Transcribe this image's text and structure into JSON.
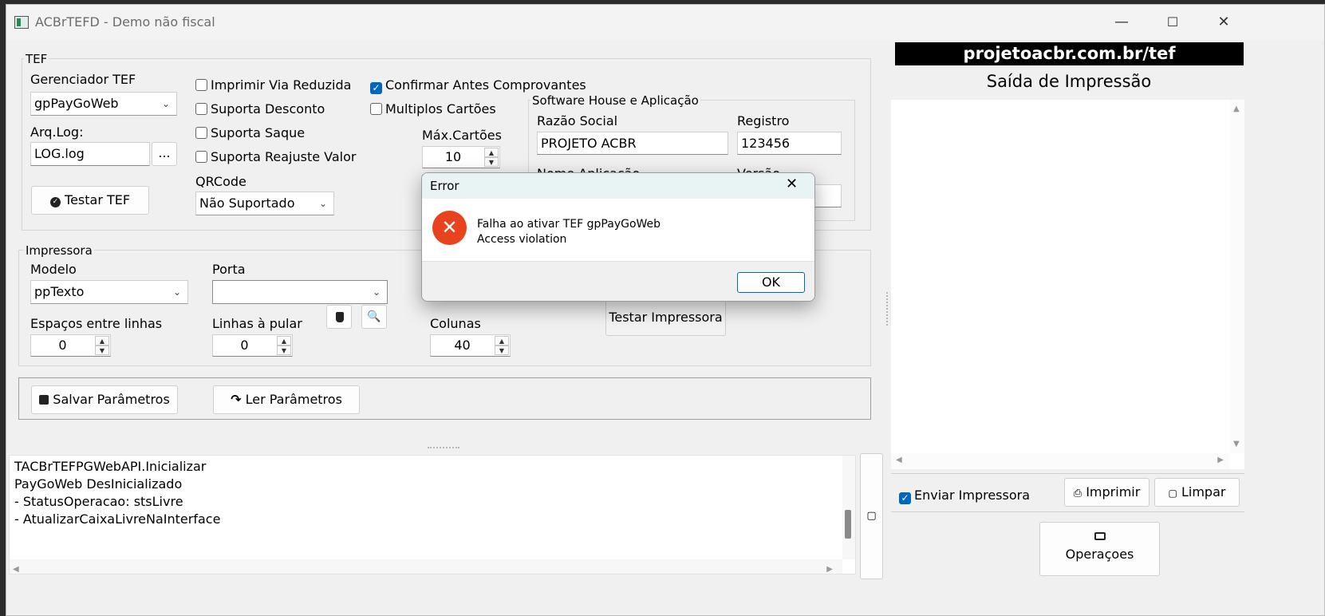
{
  "window": {
    "title": "ACBrTEFD - Demo não fiscal",
    "minimize_glyph": "—",
    "maximize_glyph": "☐",
    "close_glyph": "✕"
  },
  "tef": {
    "group_title": "TEF",
    "gerenciador_label": "Gerenciador TEF",
    "gerenciador_value": "gpPayGoWeb",
    "arqlog_label": "Arq.Log:",
    "arqlog_value": "LOG.log",
    "browse_label": "...",
    "testar_label": "Testar TEF",
    "qrcode_label": "QRCode",
    "qrcode_value": "Não Suportado",
    "options": [
      {
        "label": "Imprimir Via Reduzida",
        "checked": false
      },
      {
        "label": "Suporta Desconto",
        "checked": false
      },
      {
        "label": "Suporta Saque",
        "checked": false
      },
      {
        "label": "Suporta Reajuste Valor",
        "checked": false
      }
    ],
    "confirmar_label": "Confirmar Antes Comprovantes",
    "multiplos_label": "Multiplos Cartões",
    "max_cartoes_label": "Máx.Cartões",
    "max_cartoes_value": "10",
    "partial_label": "T",
    "software_house": {
      "group_title": "Software House e Aplicação",
      "razao_label": "Razão Social",
      "razao_value": "PROJETO ACBR",
      "registro_label": "Registro",
      "registro_value": "123456",
      "nome_app_label": "Nome Aplicação",
      "versao_label": "Versão"
    }
  },
  "impressora": {
    "group_title": "Impressora",
    "modelo_label": "Modelo",
    "modelo_value": "ppTexto",
    "porta_label": "Porta",
    "porta_value": "",
    "espacos_label": "Espaços entre linhas",
    "espacos_value": "0",
    "linhas_label": "Linhas à pular",
    "linhas_value": "0",
    "colunas_label": "Colunas",
    "colunas_value": "40",
    "testar_label": "Testar Impressora"
  },
  "actions": {
    "salvar_label": "Salvar Parâmetros",
    "ler_label": "Ler Parâmetros"
  },
  "log": {
    "lines": [
      "TACBrTEFPGWebAPI.Inicializar",
      "PayGoWeb DesInicializado",
      "- StatusOperacao: stsLivre",
      "- AtualizarCaixaLivreNaInterface"
    ]
  },
  "right_panel": {
    "banner": "projetoacbr.com.br/tef",
    "saida_title": "Saída de Impressão",
    "enviar_label": "Enviar Impressora",
    "enviar_checked": true,
    "imprimir_label": "Imprimir",
    "limpar_label": "Limpar",
    "operacoes_label": "Operaçoes"
  },
  "dialog": {
    "title": "Error",
    "message_line1": "Falha ao ativar TEF gpPayGoWeb",
    "message_line2": "Access violation",
    "ok_label": "OK"
  },
  "colors": {
    "accent": "#0067c0",
    "error_red": "#e8431f",
    "banner_bg": "#000000"
  }
}
